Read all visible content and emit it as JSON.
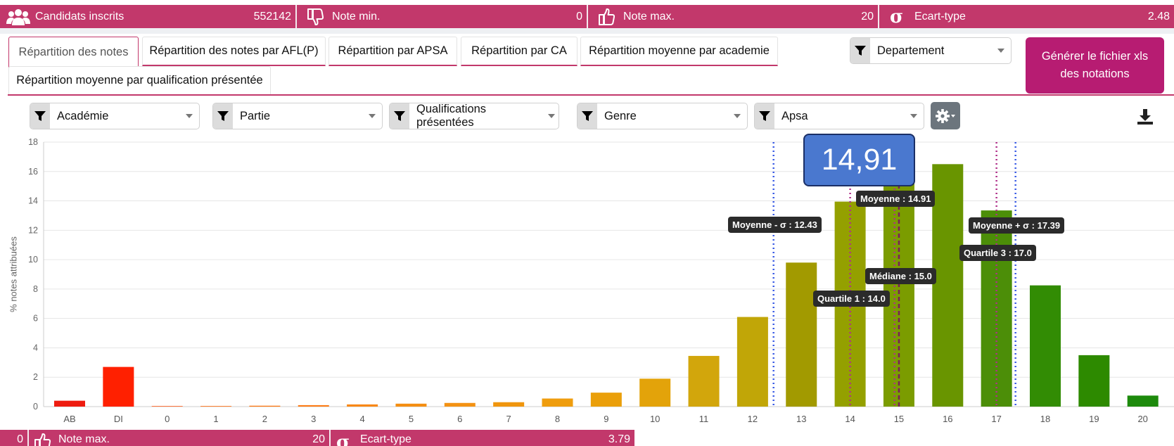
{
  "stats": {
    "candidats_label": "Candidats inscrits",
    "candidats_value": "552142",
    "note_min_label": "Note min.",
    "note_min_value": "0",
    "note_max_label": "Note max.",
    "note_max_value": "20",
    "ecart_label": "Ecart-type",
    "ecart_value": "2.48"
  },
  "tabs": [
    {
      "label": "Répartition des notes"
    },
    {
      "label": "Répartition des notes par AFL(P)"
    },
    {
      "label": "Répartition par APSA"
    },
    {
      "label": "Répartition par CA"
    },
    {
      "label": "Répartition moyenne par academie"
    },
    {
      "label": "Répartition moyenne par qualification présentée"
    }
  ],
  "filters": {
    "departement": "Departement",
    "academie": "Académie",
    "partie": "Partie",
    "qualifications": "Qualifications présentées",
    "genre": "Genre",
    "apsa": "Apsa"
  },
  "generate_button": "Générer le fichier xls des notations",
  "chart_data": {
    "type": "bar",
    "ylabel": "% notes attribuées",
    "xlabel": "",
    "ylim": [
      0,
      18
    ],
    "yticks": [
      0,
      2,
      4,
      6,
      8,
      10,
      12,
      14,
      16,
      18
    ],
    "categories": [
      "AB",
      "DI",
      "0",
      "1",
      "2",
      "3",
      "4",
      "5",
      "6",
      "7",
      "8",
      "9",
      "10",
      "11",
      "12",
      "13",
      "14",
      "15",
      "16",
      "17",
      "18",
      "19",
      "20"
    ],
    "values": [
      0.4,
      2.7,
      0.02,
      0.04,
      0.06,
      0.1,
      0.15,
      0.2,
      0.25,
      0.3,
      0.55,
      0.95,
      1.9,
      3.45,
      6.1,
      9.8,
      13.95,
      15.5,
      16.5,
      13.35,
      8.25,
      3.5,
      0.75
    ],
    "colors": [
      "#ee1c10",
      "#ff2000",
      "#ff5510",
      "#ff6a0a",
      "#ff7712",
      "#fd7c17",
      "#f88817",
      "#f48e12",
      "#f39214",
      "#f0960e",
      "#ef9d0e",
      "#ea9f0a",
      "#e3a30a",
      "#d2a60c",
      "#c1a607",
      "#a29a00",
      "#94a000",
      "#7b9c00",
      "#699500",
      "#4c8e08",
      "#328c04",
      "#2d8a00",
      "#1d8a0c"
    ],
    "reference_lines": [
      {
        "label": "Moyenne - σ : 12.43",
        "x": 12.43,
        "color": "#3a5be6",
        "style": "dotted"
      },
      {
        "label": "Quartile 1 : 14.0",
        "x": 14.0,
        "color": "#b0308a",
        "style": "dotted"
      },
      {
        "label": "Moyenne : 14.91",
        "x": 14.91,
        "color": "#b0308a",
        "style": "dotted"
      },
      {
        "label": "Médiane : 15.0",
        "x": 15.0,
        "color": "#7a1f5a",
        "style": "dashed"
      },
      {
        "label": "Quartile 3 : 17.0",
        "x": 17.0,
        "color": "#b0308a",
        "style": "dotted"
      },
      {
        "label": "Moyenne + σ : 17.39",
        "x": 17.39,
        "color": "#3a5be6",
        "style": "dotted"
      }
    ],
    "highlight_value": "14,91"
  },
  "bottom_stats": {
    "note_min_value": "0",
    "note_max_label": "Note max.",
    "note_max_value": "20",
    "ecart_label": "Ecart-type",
    "ecart_value": "3.79"
  }
}
